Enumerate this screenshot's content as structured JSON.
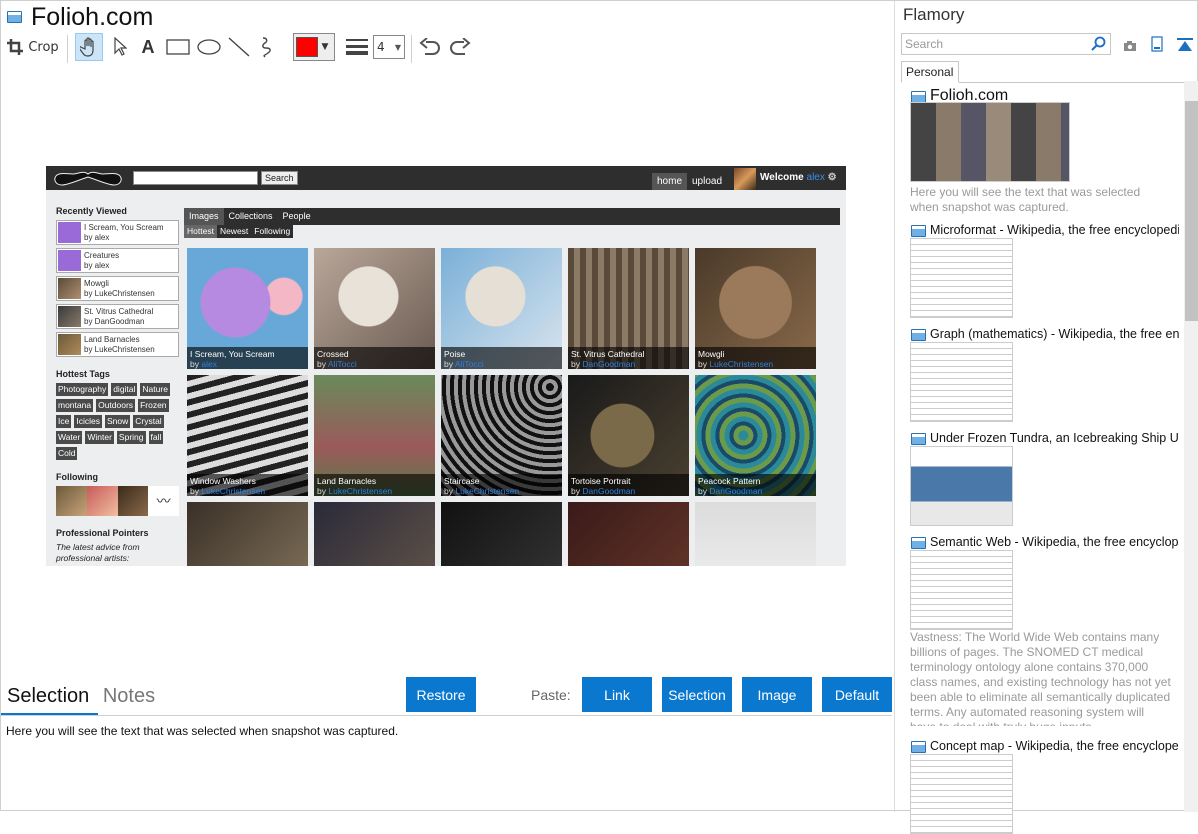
{
  "window": {
    "title": "Folioh.com"
  },
  "toolbar": {
    "crop_label": "Crop",
    "line_width": "4",
    "color": "#ff0000"
  },
  "snapshot": {
    "nav": {
      "search_button": "Search",
      "home": "home",
      "upload": "upload",
      "welcome": "Welcome",
      "user": "alex"
    },
    "sidebar": {
      "recently_viewed_heading": "Recently Viewed",
      "recent": [
        {
          "title": "I Scream, You Scream",
          "by": "by alex"
        },
        {
          "title": "Creatures",
          "by": "by alex"
        },
        {
          "title": "Mowgli",
          "by": "by LukeChristensen"
        },
        {
          "title": "St. Vitrus Cathedral",
          "by": "by DanGoodman"
        },
        {
          "title": "Land Barnacles",
          "by": "by LukeChristensen"
        }
      ],
      "tags_heading": "Hottest Tags",
      "tags": [
        "Photography",
        "digital",
        "Nature",
        "montana",
        "Outdoors",
        "Frozen",
        "Ice",
        "Icicles",
        "Snow",
        "Crystal",
        "Water",
        "Winter",
        "Spring",
        "fall",
        "Cold"
      ],
      "following_heading": "Following",
      "pointers_heading": "Professional Pointers",
      "pointers_text": "The latest advice from professional artists:"
    },
    "tabs": [
      "Images",
      "Collections",
      "People"
    ],
    "subtabs": [
      "Hottest",
      "Newest",
      "Following"
    ],
    "tiles": [
      {
        "title": "I Scream, You Scream",
        "by": "by",
        "author": "alex"
      },
      {
        "title": "Crossed",
        "by": "by",
        "author": "AliTocci"
      },
      {
        "title": "Poise",
        "by": "by",
        "author": "AliTocci"
      },
      {
        "title": "St. Vitrus Cathedral",
        "by": "by",
        "author": "DanGoodman"
      },
      {
        "title": "Mowgli",
        "by": "by",
        "author": "LukeChristensen"
      },
      {
        "title": "Window Washers",
        "by": "by",
        "author": "LukeChristensen"
      },
      {
        "title": "Land Barnacles",
        "by": "by",
        "author": "LukeChristensen"
      },
      {
        "title": "Staircase",
        "by": "by",
        "author": "LukeChristensen"
      },
      {
        "title": "Tortoise Portrait",
        "by": "by",
        "author": "DanGoodman"
      },
      {
        "title": "Peacock Pattern",
        "by": "by",
        "author": "DanGoodman"
      }
    ]
  },
  "bottom": {
    "tab_selection": "Selection",
    "tab_notes": "Notes",
    "restore": "Restore",
    "paste_label": "Paste:",
    "paste_buttons": [
      "Link",
      "Selection",
      "Image",
      "Default"
    ],
    "selection_text": "Here you will see the text that was selected when snapshot was captured."
  },
  "right": {
    "title": "Flamory",
    "search_placeholder": "Search",
    "tab_personal": "Personal",
    "snapshots": [
      {
        "title": "Folioh.com",
        "text": "Here you will see the text that was selected when snapshot was captured."
      },
      {
        "title": "Microformat - Wikipedia, the free encyclopedia"
      },
      {
        "title": "Graph (mathematics) - Wikipedia, the free encyclopedia"
      },
      {
        "title": "Under Frozen Tundra, an Icebreaking Ship Uncovers"
      },
      {
        "title": "Semantic Web - Wikipedia, the free encyclopedia",
        "text": "Vastness: The World Wide Web contains many billions of pages. The SNOMED CT medical terminology ontology alone contains 370,000 class names, and existing technology has not yet been able to eliminate all semantically duplicated terms. Any automated reasoning system will have to deal with truly huge inputs."
      },
      {
        "title": "Concept map - Wikipedia, the free encyclopedia"
      }
    ]
  }
}
